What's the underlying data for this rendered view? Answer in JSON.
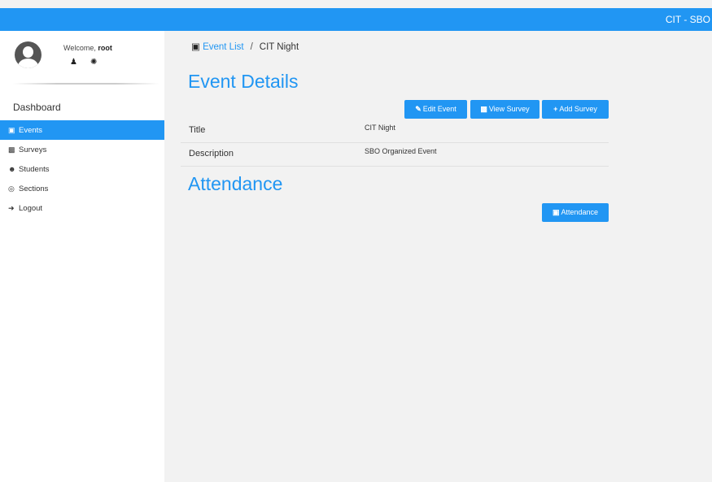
{
  "topbar": {
    "brand": "CIT - SBO"
  },
  "user": {
    "welcome_prefix": "Welcome, ",
    "username": "root",
    "icons": [
      "user-icon",
      "gear-icon"
    ]
  },
  "sidebar": {
    "header": "Dashboard",
    "items": [
      {
        "label": "Events",
        "icon": "calendar-icon",
        "active": true
      },
      {
        "label": "Surveys",
        "icon": "poll-icon"
      },
      {
        "label": "Students",
        "icon": "users-icon"
      },
      {
        "label": "Sections",
        "icon": "target-icon"
      },
      {
        "label": "Logout",
        "icon": "sign-out-icon"
      }
    ]
  },
  "breadcrumb": {
    "link": "Event List",
    "separator": "/",
    "current": "CIT Night"
  },
  "details": {
    "heading": "Event Details",
    "buttons": {
      "edit": "Edit Event",
      "view_survey": "View Survey",
      "add_survey": "Add Survey"
    },
    "rows": [
      {
        "label": "Title",
        "value": "CIT Night"
      },
      {
        "label": "Description",
        "value": "SBO Organized Event"
      }
    ]
  },
  "attendance": {
    "heading": "Attendance",
    "button": "Attendance"
  },
  "colors": {
    "accent": "#2196f3",
    "background": "#f2f2f2",
    "sidebar": "#ffffff"
  }
}
